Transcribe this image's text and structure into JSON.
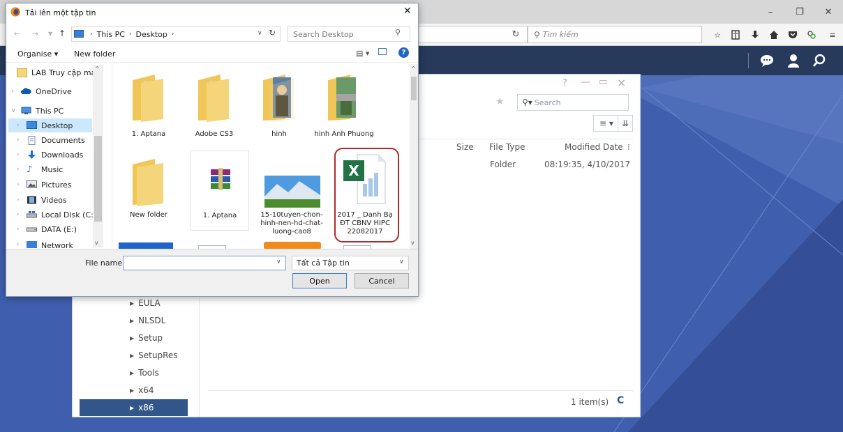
{
  "colors": {
    "desktop": "#3f5fae",
    "app_header": "#273a5c",
    "selection": "#325689",
    "nav_selection": "#cce8ff",
    "highlight_ring": "#b32a2a",
    "folder_yellow": "#f5d57a"
  },
  "firefox": {
    "search_placeholder": "Tìm kiếm",
    "window_controls": {
      "minimize": "–",
      "restore": "❐",
      "close": "✕"
    },
    "toolbar_icons": [
      "star-icon",
      "reading-list-icon",
      "download-icon",
      "home-icon",
      "pocket-icon",
      "extension-icon",
      "menu-icon"
    ]
  },
  "app_header": {
    "icons": [
      "chat-icon",
      "user-icon",
      "search-icon"
    ]
  },
  "file_manager": {
    "search_placeholder": "Search",
    "columns": [
      "Size",
      "File Type",
      "Modified Date"
    ],
    "row": {
      "type": "Folder",
      "modified": "08:19:35, 4/10/2017"
    },
    "tree": [
      {
        "label": "EULA"
      },
      {
        "label": "NLSDL"
      },
      {
        "label": "Setup"
      },
      {
        "label": "SetupRes"
      },
      {
        "label": "Tools"
      },
      {
        "label": "x64"
      },
      {
        "label": "x86"
      }
    ],
    "item_count": "1 item(s)"
  },
  "dialog": {
    "title": "Tải lên một tập tin",
    "address": {
      "this_pc": "This PC",
      "desktop": "Desktop"
    },
    "search_placeholder": "Search Desktop",
    "organise": "Organise ▾",
    "new_folder": "New folder",
    "nav": [
      {
        "label": "LAB Truy cập mạ",
        "icon": "folder-icon"
      },
      {
        "label": "OneDrive",
        "icon": "cloud-icon"
      },
      {
        "label": "This PC",
        "icon": "computer-icon"
      },
      {
        "label": "Desktop",
        "icon": "desktop-icon"
      },
      {
        "label": "Documents",
        "icon": "document-icon"
      },
      {
        "label": "Downloads",
        "icon": "download-icon"
      },
      {
        "label": "Music",
        "icon": "music-icon"
      },
      {
        "label": "Pictures",
        "icon": "picture-icon"
      },
      {
        "label": "Videos",
        "icon": "video-icon"
      },
      {
        "label": "Local Disk (C:)",
        "icon": "disk-icon"
      },
      {
        "label": "DATA (E:)",
        "icon": "drive-icon"
      },
      {
        "label": "Network",
        "icon": "network-icon"
      }
    ],
    "files": [
      {
        "name": "1. Aptana",
        "icon": "folder-icon"
      },
      {
        "name": "Adobe CS3",
        "icon": "folder-icon"
      },
      {
        "name": "hinh",
        "icon": "folder-icon"
      },
      {
        "name": "hinh Anh Phuong",
        "icon": "folder-icon"
      },
      {
        "name": "New folder",
        "icon": "folder-icon"
      },
      {
        "name": "1. Aptana",
        "icon": "archive-icon"
      },
      {
        "name": "15-10tuyen-chon-hinh-nen-hd-chat-luong-cao8",
        "icon": "image-icon"
      },
      {
        "name": "2017 _ Danh Bạ ĐT CBNV HIPC 22082017",
        "icon": "excel-icon"
      }
    ],
    "file_name_label": "File name:",
    "file_name_value": "",
    "filter": "Tất cả Tập tin",
    "open": "Open",
    "cancel": "Cancel"
  }
}
